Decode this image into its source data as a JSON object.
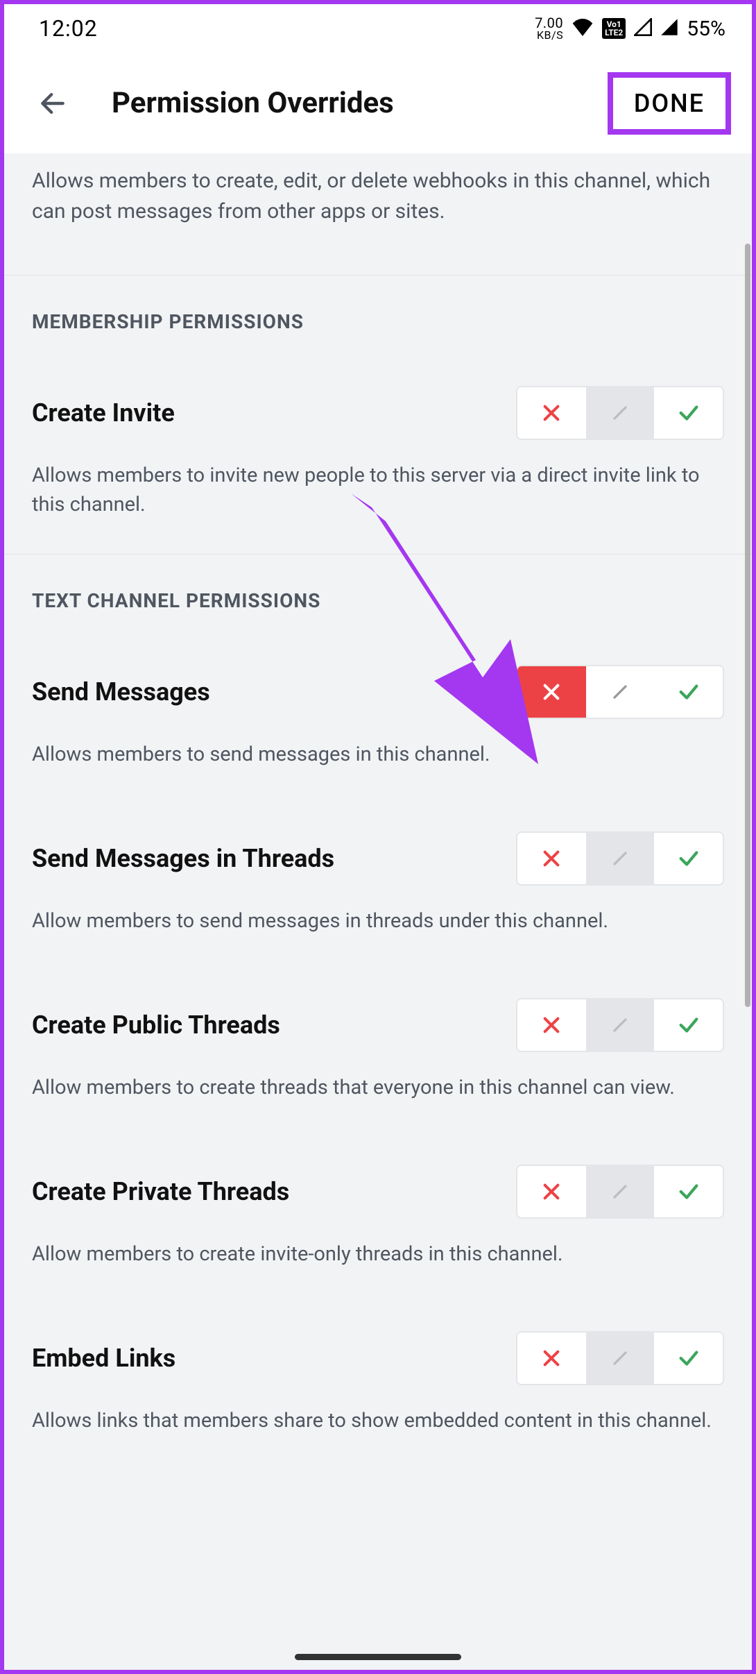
{
  "status": {
    "time": "12:02",
    "kbs_top": "7.00",
    "kbs_bottom": "KB/S",
    "lte_top": "Vo1",
    "lte_bottom": "LTE2",
    "battery": "55%"
  },
  "header": {
    "title": "Permission Overrides",
    "done": "DONE"
  },
  "intro_desc": "Allows members to create, edit, or delete webhooks in this channel, which can post messages from other apps or sites.",
  "sections": {
    "membership": "MEMBERSHIP PERMISSIONS",
    "text_channel": "TEXT CHANNEL PERMISSIONS"
  },
  "perms": {
    "create_invite": {
      "title": "Create Invite",
      "desc": "Allows members to invite new people to this server via a direct invite link to this channel."
    },
    "send_messages": {
      "title": "Send Messages",
      "desc": "Allows members to send messages in this channel."
    },
    "send_messages_threads": {
      "title": "Send Messages in Threads",
      "desc": "Allow members to send messages in threads under this channel."
    },
    "create_public_threads": {
      "title": "Create Public Threads",
      "desc": "Allow members to create threads that everyone in this channel can view."
    },
    "create_private_threads": {
      "title": "Create Private Threads",
      "desc": "Allow members to create invite-only threads in this channel."
    },
    "embed_links": {
      "title": "Embed Links",
      "desc": "Allows links that members share to show embedded content in this channel."
    }
  },
  "annotation": {
    "color": "#a437f0"
  }
}
